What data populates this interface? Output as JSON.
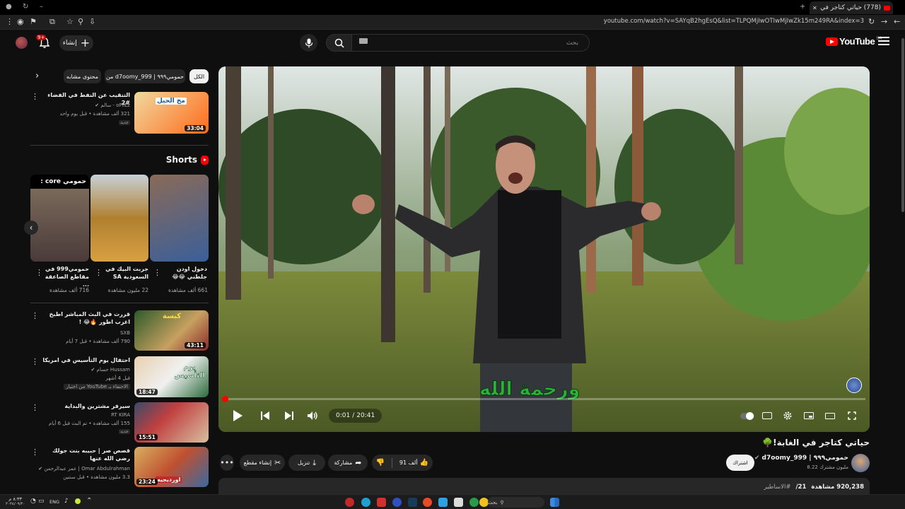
{
  "browser": {
    "tab_title": "(778) حياتي كتاجر في الغابة! - YouTube",
    "url": "youtube.com/watch?v=SAYqB2hgEsQ&list=TLPQMjIwOTIwMjIwZk15m249RA&index=3"
  },
  "header": {
    "logo_text": "YouTube",
    "country_code": "SA",
    "search_placeholder": "بحث",
    "create_label": "إنشاء",
    "notification_count": "9+"
  },
  "player": {
    "caption_text": "ورحمة الله",
    "time_current": "0:01",
    "time_separator": "/",
    "time_total": "20:41",
    "progress_fraction": 0.001
  },
  "video": {
    "title": "حياتي كتاجر في الغابة!🌳",
    "channel_name": "d7oomy_999 | حمومي٩٩٩",
    "channel_subscribers": "8.22 مليون مشترك",
    "subscribe_label": "اشتراك",
    "like_count": "91 ألف",
    "share_label": "مشاركة",
    "download_label": "تنزيل",
    "clip_label": "إنشاء مقطع",
    "views_line": "920,238 مشاهدة",
    "date_line": "21/",
    "hashtag": "#الاساطير"
  },
  "sidebar": {
    "chips": [
      {
        "label": "الكل"
      },
      {
        "label": "من d7oomy_999 | حمومي٩٩٩"
      },
      {
        "label": "محتوى مشابه"
      }
    ],
    "top_video": {
      "title": "التنقيب عن النفط في الفضاء #2",
      "channel": "oPiiLz - سالم",
      "meta": "321 ألف مشاهدة • قبل يوم واحد",
      "badge": "جديد",
      "duration": "33:04",
      "thumb_text": "مخ الحيل"
    },
    "shorts_heading": "Shorts",
    "shorts": [
      {
        "title": "دخول اودن جلطني 😂😂",
        "views": "661 ألف مشاهدة"
      },
      {
        "title": "جربت البيك في السعودية SA",
        "views": "22 مليون مشاهدة"
      },
      {
        "title": "حمومي999 في مقاطع الصاعقة ...",
        "views": "716 ألف مشاهدة"
      }
    ],
    "shorts_overlay_text": "حمومي core :",
    "videos": [
      {
        "title": "قررت في البث المباشر اطبخ اغرب اطور 🔥😂 !",
        "channel": "SXB",
        "meta": "790 ألف مشاهدة • قبل 7 أيام",
        "duration": "43:11",
        "thumb_text": "كبسة"
      },
      {
        "title": "احتفال يوم التأسيس في امريكا",
        "channel": "Hussam حسام",
        "meta": "قبل 4 أشهر",
        "duration": "18:47",
        "thumb_text": "يوم التأسيس",
        "badge": "الاحتفاء بـ YouTube من اختيار"
      },
      {
        "title": "سيرفر مشترين والبداية",
        "channel": "RT KIRA",
        "meta": "155 ألف مشاهدة • تم البث قبل 6 أيام",
        "badge": "جديد",
        "duration": "15:51"
      },
      {
        "title": "قصص صر | حبيبه بنت جولك رضي الله عنها",
        "channel": "Omar Abdulrahman | عمر عبدالرحمن",
        "meta": "3.3 مليون مشاهدة • قبل سنتين",
        "duration": "23:24",
        "thumb_text": "اورديجيه"
      }
    ]
  },
  "taskbar": {
    "search_label": "بحث",
    "lang": "ENG",
    "time": "٨:٣٣ م",
    "date": "٢٠٢٤/٠٩/٢٠"
  },
  "colors": {
    "accent": "#ff0000",
    "background": "#0f0f0f",
    "surface": "#272727"
  }
}
